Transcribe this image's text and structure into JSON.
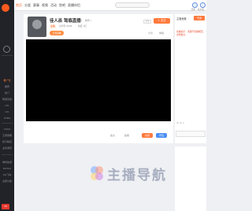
{
  "colors": {
    "accent": "#ff7a3d",
    "link_blue": "#4a8ff5",
    "sidebar_bg": "#222328",
    "player_bg": "#000000",
    "alert_red": "#e84a2c"
  },
  "sidebar": {
    "items": [
      {
        "label": "推广位",
        "icon": "home-icon"
      },
      {
        "label": "推荐",
        "icon": ""
      },
      {
        "label": "热门",
        "icon": ""
      },
      {
        "label": "网游竞技",
        "icon": ""
      },
      {
        "label": "LPL",
        "icon": ""
      },
      {
        "label": "LOL",
        "icon": ""
      },
      {
        "label": "PUBG",
        "icon": ""
      },
      {
        "label": "CSGO",
        "icon": ""
      },
      {
        "label": "王者荣耀",
        "icon": ""
      },
      {
        "label": "和平精英",
        "icon": ""
      },
      {
        "label": "主机游戏",
        "icon": ""
      },
      {
        "label": "单机热游",
        "icon": ""
      },
      {
        "label": "DOTA2",
        "icon": ""
      },
      {
        "label": "QQ飞车",
        "icon": ""
      },
      {
        "label": "全部分类",
        "icon": ""
      }
    ],
    "badge": "33"
  },
  "topbar": {
    "nav": [
      "首页",
      "分类",
      "赛事",
      "视频",
      "活动",
      "鱼吧",
      "直播伴侣"
    ],
    "active_index": 0,
    "search_placeholder": "",
    "icons": [
      {
        "name": "history-icon",
        "label": "历史"
      },
      {
        "name": "download-icon",
        "label": "客户端"
      }
    ]
  },
  "room": {
    "title": "佳人杀 驾临直播",
    "subtitle": "热门话题 ·· 推荐+",
    "tag": "主播",
    "meta1": "房间号 9999",
    "meta2": "热度 1亿",
    "category": "王者荣耀",
    "follow_label": "+ 关注",
    "share_box": "分享",
    "actions": [
      "分享",
      "举报"
    ],
    "bottom_items": [
      "鱼丸",
      "鱼翅"
    ],
    "bottom_btn_orange": "充值",
    "bottom_btn_blue": "背包"
  },
  "right_panel": {
    "header": "主播贡献",
    "button": "开通",
    "notice": "系统提示：请遵守直播规范，文明发言。",
    "chat_tools": "☺ ⚙ ↩"
  },
  "watermark": {
    "text": "主播导航"
  }
}
